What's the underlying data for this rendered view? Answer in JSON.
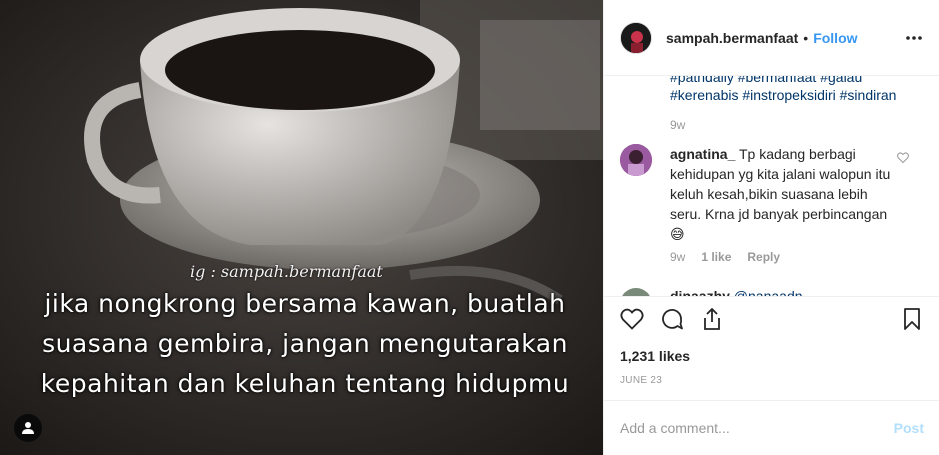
{
  "photo": {
    "ig_handle": "ig : sampah.bermanfaat",
    "quote_lines": [
      "jika nongkrong bersama kawan, buatlah",
      "suasana gembira, jangan mengutarakan",
      "kepahitan dan keluhan tentang hidupmu"
    ],
    "user_tag_icon": "user-icon"
  },
  "header": {
    "username": "sampah.bermanfaat",
    "separator": "•",
    "follow_label": "Follow",
    "more_icon": "ellipsis-icon"
  },
  "caption": {
    "hashtags_line1": "#pathdaily #bermanfaat #galau",
    "hashtags_line2": "#kerenabis #instropeksidiri #sindiran",
    "timestamp": "9w"
  },
  "comments": [
    {
      "username": "agnatina_",
      "text": "Tp kadang berbagi kehidupan yg kita jalani walopun itu keluh kesah,bikin suasana lebih seru. Krna jd banyak perbincangan😅",
      "timestamp": "9w",
      "likes": "1 like",
      "reply_label": "Reply"
    },
    {
      "username": "dinaazhy",
      "mention": "@nanaadn"
    }
  ],
  "actions": {
    "like_icon": "heart-icon",
    "comment_icon": "comment-icon",
    "share_icon": "share-icon",
    "save_icon": "bookmark-icon"
  },
  "likes_count": "1,231 likes",
  "post_date": "JUNE 23",
  "add_comment": {
    "placeholder": "Add a comment...",
    "post_label": "Post"
  },
  "colors": {
    "link_blue": "#3897f0",
    "hashtag": "#003569",
    "muted": "#999999",
    "post_disabled": "#b2dffc"
  }
}
